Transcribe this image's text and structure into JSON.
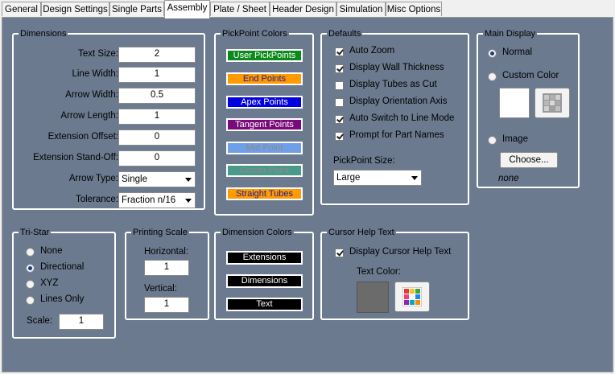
{
  "tabs": [
    {
      "label": "General"
    },
    {
      "label": "Design Settings"
    },
    {
      "label": "Single Parts"
    },
    {
      "label": "Assembly",
      "active": true
    },
    {
      "label": "Plate / Sheet"
    },
    {
      "label": "Header Design"
    },
    {
      "label": "Simulation"
    },
    {
      "label": "Misc Options"
    }
  ],
  "dimensions": {
    "title": "Dimensions",
    "text_size": {
      "label": "Text Size:",
      "value": "2"
    },
    "line_width": {
      "label": "Line Width:",
      "value": "1"
    },
    "arrow_width": {
      "label": "Arrow Width:",
      "value": "0.5"
    },
    "arrow_length": {
      "label": "Arrow Length:",
      "value": "1"
    },
    "extension_offset": {
      "label": "Extension Offset:",
      "value": "0"
    },
    "extension_standoff": {
      "label": "Extension Stand-Off:",
      "value": "0"
    },
    "arrow_type": {
      "label": "Arrow Type:",
      "value": "Single"
    },
    "tolerance": {
      "label": "Tolerance:",
      "value": "Fraction n/16"
    }
  },
  "pickpoint_colors": {
    "title": "PickPoint Colors",
    "buttons": [
      {
        "label": "User PickPoints",
        "bg": "#0a8a1a",
        "fg": "#ffffff"
      },
      {
        "label": "End Points",
        "bg": "#ff9a00",
        "fg": "#1a1aa0"
      },
      {
        "label": "Apex Points",
        "bg": "#0000e0",
        "fg": "#ffffff"
      },
      {
        "label": "Tangent Points",
        "bg": "#7a0a7a",
        "fg": "#ffffff"
      },
      {
        "label": "Mid Point",
        "bg": "#6f9fe8",
        "fg": "#8a8a8a"
      },
      {
        "label": "Center Point",
        "bg": "#4a9a8a",
        "fg": "#8a8a8a"
      },
      {
        "label": "Straight Tubes",
        "bg": "#ff9a00",
        "fg": "#1a1aa0"
      }
    ]
  },
  "defaults": {
    "title": "Defaults",
    "options": [
      {
        "label": "Auto Zoom",
        "checked": true
      },
      {
        "label": "Display Wall Thickness",
        "checked": true
      },
      {
        "label": "Display Tubes as Cut",
        "checked": false
      },
      {
        "label": "Display Orientation Axis",
        "checked": false
      },
      {
        "label": "Auto Switch to Line Mode",
        "checked": true
      },
      {
        "label": "Prompt for Part Names",
        "checked": true
      }
    ],
    "pickpoint_size_label": "PickPoint Size:",
    "pickpoint_size_value": "Large"
  },
  "main_display": {
    "title": "Main Display",
    "normal": "Normal",
    "custom_color": "Custom Color",
    "image": "Image",
    "choose_button": "Choose...",
    "image_name": "none"
  },
  "tristar": {
    "title": "Tri-Star",
    "options": [
      {
        "label": "None",
        "selected": false
      },
      {
        "label": "Directional",
        "selected": true
      },
      {
        "label": "XYZ",
        "selected": false
      },
      {
        "label": "Lines Only",
        "selected": false
      }
    ],
    "scale_label": "Scale:",
    "scale_value": "1"
  },
  "printing_scale": {
    "title": "Printing Scale",
    "horizontal_label": "Horizontal:",
    "horizontal_value": "1",
    "vertical_label": "Vertical:",
    "vertical_value": "1"
  },
  "dimension_colors": {
    "title": "Dimension Colors",
    "buttons": [
      "Extensions",
      "Dimensions",
      "Text"
    ]
  },
  "cursor_help": {
    "title": "Cursor Help Text",
    "display_label": "Display Cursor Help Text",
    "display_checked": true,
    "text_color_label": "Text Color:",
    "text_color": "#6b6b6b"
  },
  "colors": {
    "panel": "#6b7a8f"
  }
}
